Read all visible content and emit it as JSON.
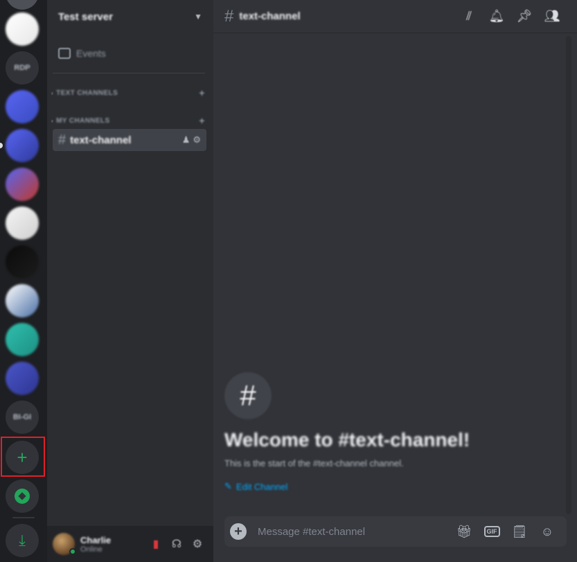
{
  "servers": [
    {
      "kind": "image",
      "colors": [
        "#ffffff",
        "#e6e6e6"
      ]
    },
    {
      "kind": "text",
      "label": "RDP"
    },
    {
      "kind": "image",
      "colors": [
        "#5865f2",
        "#3a4bbf"
      ]
    },
    {
      "kind": "image",
      "colors": [
        "#5865f2",
        "#2f3a9a"
      ]
    },
    {
      "kind": "image",
      "colors": [
        "#5865f2",
        "#c0392b"
      ]
    },
    {
      "kind": "image",
      "colors": [
        "#f5f5f5",
        "#cfcfcf"
      ]
    },
    {
      "kind": "image",
      "colors": [
        "#0b0b0b",
        "#1c1c1c"
      ]
    },
    {
      "kind": "image",
      "colors": [
        "#ffffff",
        "#4a6fa5"
      ]
    },
    {
      "kind": "image",
      "colors": [
        "#2fbfae",
        "#1d8f82"
      ]
    },
    {
      "kind": "image",
      "colors": [
        "#4b56c9",
        "#2d3590"
      ]
    },
    {
      "kind": "text",
      "label": "BI-GI"
    }
  ],
  "rail": {
    "add_server_symbol": "+",
    "explore_symbol": "◎",
    "download_symbol": "⤓",
    "accent": "#23a55a"
  },
  "guild": {
    "name": "Test server",
    "events_label": "Events",
    "categories": [
      "TEXT CHANNELS",
      "MY CHANNELS"
    ],
    "channel": "text-channel"
  },
  "user": {
    "name": "Charlie",
    "status": "Online"
  },
  "topbar": {
    "channel": "text-channel",
    "icons": [
      "threads-icon",
      "bell-icon",
      "pin-icon",
      "members-icon"
    ]
  },
  "welcome": {
    "symbol": "#",
    "title": "Welcome to #text-channel!",
    "subtitle": "This is the start of the #text-channel channel.",
    "edit_label": "Edit Channel"
  },
  "composer": {
    "placeholder": "Message #text-channel",
    "gif_label": "GIF"
  },
  "colors": {
    "rail_bg": "#1e1f22",
    "sidebar_bg": "#2b2d31",
    "main_bg": "#313338",
    "highlight": "#e0202a",
    "link": "#00a8fc"
  }
}
